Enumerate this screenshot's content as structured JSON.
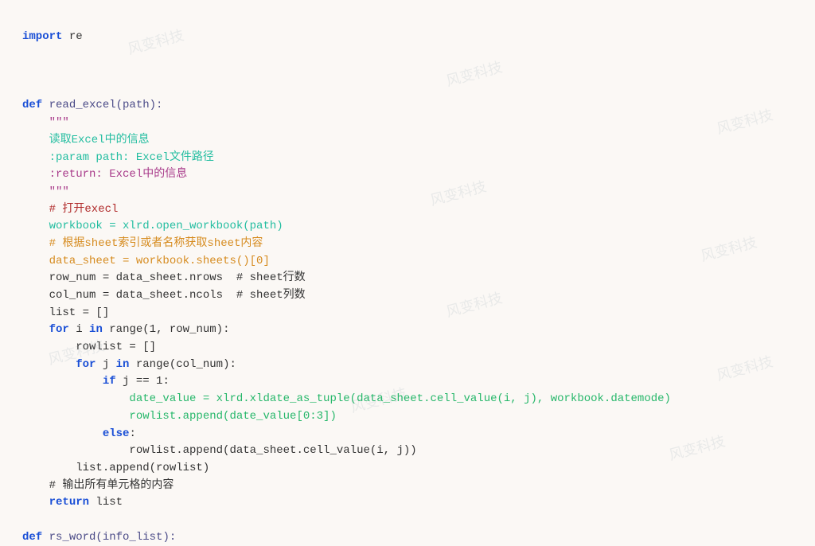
{
  "watermark": "风变科技",
  "code": {
    "l01a": "import",
    "l01b": " re",
    "l03a": "def",
    "l03b": " read_excel(path):",
    "l04": "    \"\"\"",
    "l05": "    读取Excel中的信息",
    "l06": "    :param path: Excel文件路径",
    "l07": "    :return: Excel中的信息",
    "l08": "    \"\"\"",
    "l09": "    # 打开execl",
    "l10": "    workbook = xlrd.open_workbook(path)",
    "l11": "    # 根据sheet索引或者名称获取sheet内容",
    "l12": "    data_sheet = workbook.sheets()[0]",
    "l13a": "    row_num = data_sheet.nrows  ",
    "l13b": "# sheet行数",
    "l14a": "    col_num = data_sheet.ncols  ",
    "l14b": "# sheet列数",
    "l15": "    list = []",
    "l16a": "    ",
    "l16b": "for",
    "l16c": " i ",
    "l16d": "in",
    "l16e": " range(1, row_num):",
    "l17": "        rowlist = []",
    "l18a": "        ",
    "l18b": "for",
    "l18c": " j ",
    "l18d": "in",
    "l18e": " range(col_num):",
    "l19a": "            ",
    "l19b": "if",
    "l19c": " j == 1:",
    "l20": "                date_value = xlrd.xldate_as_tuple(data_sheet.cell_value(i, j), workbook.datemode)",
    "l21": "                rowlist.append(date_value[0:3])",
    "l22a": "            ",
    "l22b": "else",
    "l22c": ":",
    "l23": "                rowlist.append(data_sheet.cell_value(i, j))",
    "l24": "        list.append(rowlist)",
    "l25": "    # 输出所有单元格的内容",
    "l26a": "    ",
    "l26b": "return",
    "l26c": " list",
    "l28a": "def",
    "l28b": " rs_word(info_list):"
  }
}
